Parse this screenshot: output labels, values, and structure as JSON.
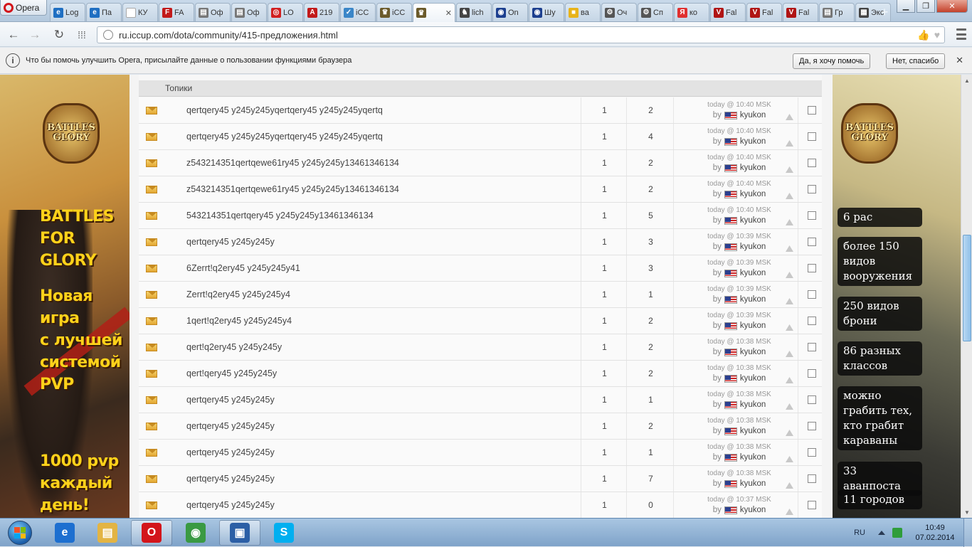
{
  "browser": {
    "menu_label": "Opera",
    "tabs": [
      {
        "label": "Log",
        "icon": "ie-icon",
        "color": "#1f6fc2"
      },
      {
        "label": "Па",
        "icon": "ie-icon",
        "color": "#1f6fc2"
      },
      {
        "label": "КУ",
        "icon": "blank-page-icon",
        "color": "#ffffff"
      },
      {
        "label": "FA",
        "icon": "fa-icon",
        "color": "#c21a1a"
      },
      {
        "label": "Оф",
        "icon": "document-icon",
        "color": "#777777"
      },
      {
        "label": "Оф",
        "icon": "document-icon",
        "color": "#777777"
      },
      {
        "label": "LO",
        "icon": "lifebuoy-icon",
        "color": "#d11f1f"
      },
      {
        "label": "219",
        "icon": "letter-a-icon",
        "color": "#c21a1a"
      },
      {
        "label": "iCC",
        "icon": "check-icon",
        "color": "#3a86c8"
      },
      {
        "label": "iCC",
        "icon": "iccup-icon",
        "color": "#6b5a2a"
      },
      {
        "label": "",
        "icon": "iccup-icon",
        "color": "#6b5a2a",
        "active": true
      },
      {
        "label": "lich",
        "icon": "chess-knight-icon",
        "color": "#444444"
      },
      {
        "label": "On",
        "icon": "eye-icon",
        "color": "#1c3f8f"
      },
      {
        "label": "Шу",
        "icon": "eye-icon",
        "color": "#1c3f8f"
      },
      {
        "label": "ва",
        "icon": "square-icon",
        "color": "#e8b319"
      },
      {
        "label": "Оч",
        "icon": "gear-icon",
        "color": "#555555"
      },
      {
        "label": "Сп",
        "icon": "gear-icon",
        "color": "#555555"
      },
      {
        "label": "ко",
        "icon": "yandex-icon",
        "color": "#e03030"
      },
      {
        "label": "Fal",
        "icon": "letter-v-icon",
        "color": "#b01515"
      },
      {
        "label": "Fal",
        "icon": "letter-v-icon",
        "color": "#b01515"
      },
      {
        "label": "Fal",
        "icon": "letter-v-icon",
        "color": "#b01515"
      },
      {
        "label": "Гр",
        "icon": "document-icon",
        "color": "#777777"
      },
      {
        "label": "Экс",
        "icon": "grid-icon",
        "color": "#444444"
      }
    ],
    "new_tab": "+",
    "url": "ru.iccup.com/dota/community/415-предложения.html"
  },
  "notification": {
    "text": "Что бы помочь улучшить Opera, присылайте данные о пользовании функциями браузера",
    "accept": "Да, я хочу помочь",
    "decline": "Нет, спасибо"
  },
  "left_ad": {
    "logo_line1": "BATTLES",
    "logo_line2": "GLORY",
    "title_line1": "BATTLES",
    "title_line2": "FOR GLORY",
    "promo_lines": [
      "Новая",
      "игра",
      "с лучшей",
      "системой",
      "PVP"
    ],
    "promo2_lines": [
      "1000 pvp",
      "каждый",
      "день!"
    ]
  },
  "right_ad": {
    "logo_line1": "BATTLES",
    "logo_line2": "GLORY",
    "boxes": [
      "6 рас",
      "более 150 видов вооружения",
      "250 видов брони",
      "86 разных классов",
      "можно грабить тех, кто грабит караваны",
      "33 аванпоста",
      "11 городов"
    ]
  },
  "forum": {
    "section_title": "Топики",
    "by_label": "by",
    "topics": [
      {
        "title": "qertqery45 y245y245yqertqery45 y245y245yqertq",
        "n1": "1",
        "n2": "2",
        "time": "today @ 10:40 MSK",
        "author": "kyukon"
      },
      {
        "title": "qertqery45 y245y245yqertqery45 y245y245yqertq",
        "n1": "1",
        "n2": "4",
        "time": "today @ 10:40 MSK",
        "author": "kyukon"
      },
      {
        "title": "z543214351qertqewe61ry45 y245y245y13461346134",
        "n1": "1",
        "n2": "2",
        "time": "today @ 10:40 MSK",
        "author": "kyukon"
      },
      {
        "title": "z543214351qertqewe61ry45 y245y245y13461346134",
        "n1": "1",
        "n2": "2",
        "time": "today @ 10:40 MSK",
        "author": "kyukon"
      },
      {
        "title": "543214351qertqery45 y245y245y13461346134",
        "n1": "1",
        "n2": "5",
        "time": "today @ 10:40 MSK",
        "author": "kyukon"
      },
      {
        "title": "qertqery45 y245y245y",
        "n1": "1",
        "n2": "3",
        "time": "today @ 10:39 MSK",
        "author": "kyukon"
      },
      {
        "title": "6Zerrt!q2ery45 y245y245y41",
        "n1": "1",
        "n2": "3",
        "time": "today @ 10:39 MSK",
        "author": "kyukon"
      },
      {
        "title": "Zerrt!q2ery45 y245y245y4",
        "n1": "1",
        "n2": "1",
        "time": "today @ 10:39 MSK",
        "author": "kyukon"
      },
      {
        "title": "1qert!q2ery45 y245y245y4",
        "n1": "1",
        "n2": "2",
        "time": "today @ 10:39 MSK",
        "author": "kyukon"
      },
      {
        "title": "qert!q2ery45 y245y245y",
        "n1": "1",
        "n2": "2",
        "time": "today @ 10:38 MSK",
        "author": "kyukon"
      },
      {
        "title": "qert!qery45 y245y245y",
        "n1": "1",
        "n2": "2",
        "time": "today @ 10:38 MSK",
        "author": "kyukon"
      },
      {
        "title": "qertqery45 y245y245y",
        "n1": "1",
        "n2": "1",
        "time": "today @ 10:38 MSK",
        "author": "kyukon"
      },
      {
        "title": "qertqery45 y245y245y",
        "n1": "1",
        "n2": "2",
        "time": "today @ 10:38 MSK",
        "author": "kyukon"
      },
      {
        "title": "qertqery45 y245y245y",
        "n1": "1",
        "n2": "1",
        "time": "today @ 10:38 MSK",
        "author": "kyukon"
      },
      {
        "title": "qertqery45 y245y245y",
        "n1": "1",
        "n2": "7",
        "time": "today @ 10:38 MSK",
        "author": "kyukon"
      },
      {
        "title": "qertqery45 y245y245y",
        "n1": "1",
        "n2": "0",
        "time": "today @ 10:37 MSK",
        "author": "kyukon"
      }
    ]
  },
  "taskbar": {
    "language": "RU",
    "time": "10:49",
    "date": "07.02.2014",
    "apps": [
      {
        "name": "ie-taskbar-icon",
        "color": "#1d6fd0",
        "glyph": "e",
        "active": false
      },
      {
        "name": "explorer-taskbar-icon",
        "color": "#e3b444",
        "glyph": "▤",
        "active": false
      },
      {
        "name": "opera-taskbar-icon",
        "color": "#d3151b",
        "glyph": "O",
        "active": true
      },
      {
        "name": "chrome-taskbar-icon",
        "color": "#3a9a43",
        "glyph": "◉",
        "active": false
      },
      {
        "name": "remote-desktop-taskbar-icon",
        "color": "#2c5fa6",
        "glyph": "▣",
        "active": true
      },
      {
        "name": "skype-taskbar-icon",
        "color": "#00aff0",
        "glyph": "S",
        "active": false
      }
    ]
  }
}
